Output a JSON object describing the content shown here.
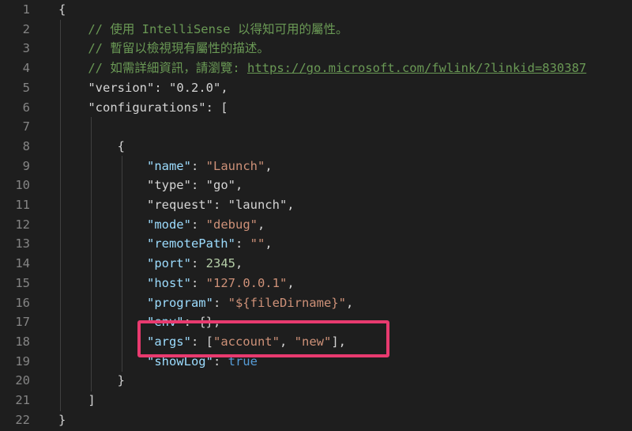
{
  "lines": [
    {
      "num": "1",
      "tokens": [
        {
          "t": "{",
          "c": "punc"
        }
      ]
    },
    {
      "num": "2",
      "tokens": [
        {
          "t": "    // 使用 IntelliSense 以得知可用的屬性。",
          "c": "comment"
        }
      ]
    },
    {
      "num": "3",
      "tokens": [
        {
          "t": "    // 暫留以檢視現有屬性的描述。",
          "c": "comment"
        }
      ]
    },
    {
      "num": "4",
      "tokens": [
        {
          "t": "    // 如需詳細資訊，請瀏覽: ",
          "c": "comment"
        },
        {
          "t": "https://go.microsoft.com/fwlink/?linkid=830387",
          "c": "link"
        }
      ]
    },
    {
      "num": "5",
      "tokens": [
        {
          "t": "    \"version\"",
          "c": "keyplain"
        },
        {
          "t": ": ",
          "c": "punc"
        },
        {
          "t": "\"0.2.0\"",
          "c": "strplain"
        },
        {
          "t": ",",
          "c": "punc"
        }
      ]
    },
    {
      "num": "6",
      "tokens": [
        {
          "t": "    \"configurations\"",
          "c": "keyplain"
        },
        {
          "t": ": [",
          "c": "punc"
        }
      ]
    },
    {
      "num": "7",
      "tokens": []
    },
    {
      "num": "8",
      "tokens": [
        {
          "t": "        {",
          "c": "punc"
        }
      ]
    },
    {
      "num": "9",
      "tokens": [
        {
          "t": "            \"name\"",
          "c": "key"
        },
        {
          "t": ": ",
          "c": "punc"
        },
        {
          "t": "\"Launch\"",
          "c": "str"
        },
        {
          "t": ",",
          "c": "punc"
        }
      ]
    },
    {
      "num": "10",
      "tokens": [
        {
          "t": "            \"type\"",
          "c": "keyplain"
        },
        {
          "t": ": ",
          "c": "punc"
        },
        {
          "t": "\"go\"",
          "c": "strplain"
        },
        {
          "t": ",",
          "c": "punc"
        }
      ]
    },
    {
      "num": "11",
      "tokens": [
        {
          "t": "            \"request\"",
          "c": "keyplain"
        },
        {
          "t": ": ",
          "c": "punc"
        },
        {
          "t": "\"launch\"",
          "c": "strplain"
        },
        {
          "t": ",",
          "c": "punc"
        }
      ]
    },
    {
      "num": "12",
      "tokens": [
        {
          "t": "            \"mode\"",
          "c": "key"
        },
        {
          "t": ": ",
          "c": "punc"
        },
        {
          "t": "\"debug\"",
          "c": "str"
        },
        {
          "t": ",",
          "c": "punc"
        }
      ]
    },
    {
      "num": "13",
      "tokens": [
        {
          "t": "            \"remotePath\"",
          "c": "key"
        },
        {
          "t": ": ",
          "c": "punc"
        },
        {
          "t": "\"\"",
          "c": "str"
        },
        {
          "t": ",",
          "c": "punc"
        }
      ]
    },
    {
      "num": "14",
      "tokens": [
        {
          "t": "            \"port\"",
          "c": "key"
        },
        {
          "t": ": ",
          "c": "punc"
        },
        {
          "t": "2345",
          "c": "num"
        },
        {
          "t": ",",
          "c": "punc"
        }
      ]
    },
    {
      "num": "15",
      "tokens": [
        {
          "t": "            \"host\"",
          "c": "key"
        },
        {
          "t": ": ",
          "c": "punc"
        },
        {
          "t": "\"127.0.0.1\"",
          "c": "str"
        },
        {
          "t": ",",
          "c": "punc"
        }
      ]
    },
    {
      "num": "16",
      "tokens": [
        {
          "t": "            \"program\"",
          "c": "key"
        },
        {
          "t": ": ",
          "c": "punc"
        },
        {
          "t": "\"${fileDirname}\"",
          "c": "str"
        },
        {
          "t": ",",
          "c": "punc"
        }
      ]
    },
    {
      "num": "17",
      "tokens": [
        {
          "t": "            \"env\"",
          "c": "key"
        },
        {
          "t": ": {},",
          "c": "punc"
        }
      ]
    },
    {
      "num": "18",
      "tokens": [
        {
          "t": "            \"args\"",
          "c": "key"
        },
        {
          "t": ": [",
          "c": "punc"
        },
        {
          "t": "\"account\"",
          "c": "str"
        },
        {
          "t": ", ",
          "c": "punc"
        },
        {
          "t": "\"new\"",
          "c": "str"
        },
        {
          "t": "],",
          "c": "punc"
        }
      ]
    },
    {
      "num": "19",
      "tokens": [
        {
          "t": "            \"showLog\"",
          "c": "key"
        },
        {
          "t": ": ",
          "c": "punc"
        },
        {
          "t": "true",
          "c": "kw"
        }
      ]
    },
    {
      "num": "20",
      "tokens": [
        {
          "t": "        }",
          "c": "punc"
        }
      ]
    },
    {
      "num": "21",
      "tokens": [
        {
          "t": "    ]",
          "c": "punc"
        }
      ]
    },
    {
      "num": "22",
      "tokens": [
        {
          "t": "}",
          "c": "punc"
        }
      ]
    }
  ],
  "colors": {
    "background": "#1e1e1e",
    "comment": "#6a9955",
    "key": "#9cdcfe",
    "string": "#ce9178",
    "number": "#b5cea8",
    "keyword": "#569cd6",
    "highlight": "#e83a6f"
  }
}
